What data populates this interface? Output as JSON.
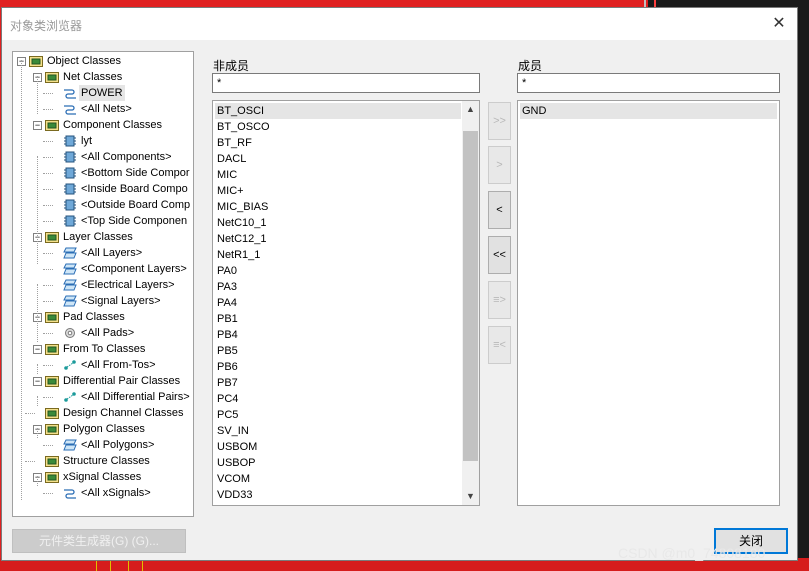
{
  "window": {
    "title": "对象类浏览器",
    "close_glyph": "✕"
  },
  "tree": {
    "rows": [
      {
        "label": "Object Classes",
        "level": 0,
        "icon": "object-classes-icon"
      },
      {
        "label": "Net Classes",
        "level": 1,
        "icon": "net-classes-icon"
      },
      {
        "label": "POWER",
        "level": 2,
        "icon": "net-class-icon",
        "selected": true
      },
      {
        "label": "<All Nets>",
        "level": 2,
        "icon": "net-class-icon"
      },
      {
        "label": "Component Classes",
        "level": 1,
        "icon": "component-classes-icon"
      },
      {
        "label": "lyt",
        "level": 2,
        "icon": "component-class-icon"
      },
      {
        "label": "<All Components>",
        "level": 2,
        "icon": "component-class-icon"
      },
      {
        "label": "<Bottom Side Compor",
        "level": 2,
        "icon": "component-class-icon"
      },
      {
        "label": "<Inside Board Compo",
        "level": 2,
        "icon": "component-class-icon"
      },
      {
        "label": "<Outside Board Comp",
        "level": 2,
        "icon": "component-class-icon"
      },
      {
        "label": "<Top Side Componen",
        "level": 2,
        "icon": "component-class-icon"
      },
      {
        "label": "Layer Classes",
        "level": 1,
        "icon": "layer-classes-icon"
      },
      {
        "label": "<All Layers>",
        "level": 2,
        "icon": "layer-class-icon"
      },
      {
        "label": "<Component Layers>",
        "level": 2,
        "icon": "layer-class-icon"
      },
      {
        "label": "<Electrical Layers>",
        "level": 2,
        "icon": "layer-class-icon"
      },
      {
        "label": "<Signal Layers>",
        "level": 2,
        "icon": "layer-class-icon"
      },
      {
        "label": "Pad Classes",
        "level": 1,
        "icon": "pad-classes-icon"
      },
      {
        "label": "<All Pads>",
        "level": 2,
        "icon": "pad-class-icon"
      },
      {
        "label": "From To Classes",
        "level": 1,
        "icon": "from-to-classes-icon"
      },
      {
        "label": "<All From-Tos>",
        "level": 2,
        "icon": "from-to-class-icon"
      },
      {
        "label": "Differential Pair Classes",
        "level": 1,
        "icon": "diff-pair-classes-icon"
      },
      {
        "label": "<All Differential Pairs>",
        "level": 2,
        "icon": "diff-pair-class-icon"
      },
      {
        "label": "Design Channel Classes",
        "level": 1,
        "icon": "design-channel-classes-icon",
        "leaf": true
      },
      {
        "label": "Polygon Classes",
        "level": 1,
        "icon": "polygon-classes-icon"
      },
      {
        "label": "<All Polygons>",
        "level": 2,
        "icon": "polygon-class-icon"
      },
      {
        "label": "Structure Classes",
        "level": 1,
        "icon": "structure-classes-icon",
        "leaf": true
      },
      {
        "label": "xSignal Classes",
        "level": 1,
        "icon": "xsignal-classes-icon"
      },
      {
        "label": "<All xSignals>",
        "level": 2,
        "icon": "xsignal-class-icon"
      }
    ]
  },
  "non_members": {
    "label": "非成员",
    "filter_value": "*",
    "items": [
      "BT_OSCI",
      "BT_OSCO",
      "BT_RF",
      "DACL",
      "MIC",
      "MIC+",
      "MIC_BIAS",
      "NetC10_1",
      "NetC12_1",
      "NetR1_1",
      "PA0",
      "PA3",
      "PA4",
      "PB1",
      "PB4",
      "PB5",
      "PB6",
      "PB7",
      "PC4",
      "PC5",
      "SV_IN",
      "USBOM",
      "USBOP",
      "VCOM",
      "VDD33"
    ]
  },
  "members": {
    "label": "成员",
    "filter_value": "*",
    "items": [
      "GND"
    ]
  },
  "transfer_buttons": {
    "add_all": ">>",
    "add": ">",
    "remove": "<",
    "remove_all": "<<",
    "add_selected": "≡>",
    "remove_selected": "≡<"
  },
  "footer": {
    "generate_label": "元件类生成器(G) (G)...",
    "close_label": "关闭"
  },
  "watermark": "CSDN @m0_74808180"
}
